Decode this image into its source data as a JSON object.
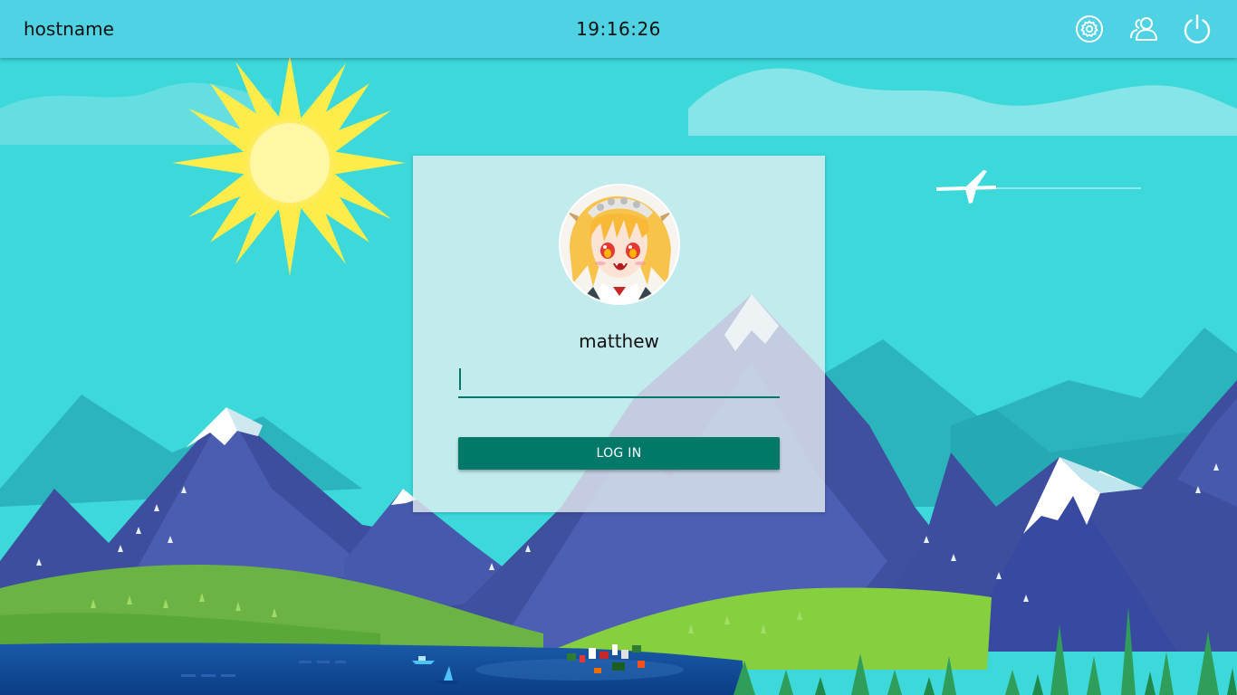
{
  "topbar": {
    "hostname": "hostname",
    "clock": "19:16:26",
    "icons": [
      "settings-gear-icon",
      "switch-user-icon",
      "power-icon"
    ],
    "background_color": "#4fd2e3"
  },
  "login": {
    "username": "matthew",
    "password_value": "",
    "button_label": "LOG IN",
    "accent_color": "#00796b"
  },
  "wallpaper": {
    "sky_color": "#3cd8da",
    "description_icons": [
      "sun-icon",
      "airplane-icon",
      "sailboat-icon",
      "motorboat-icon"
    ]
  }
}
